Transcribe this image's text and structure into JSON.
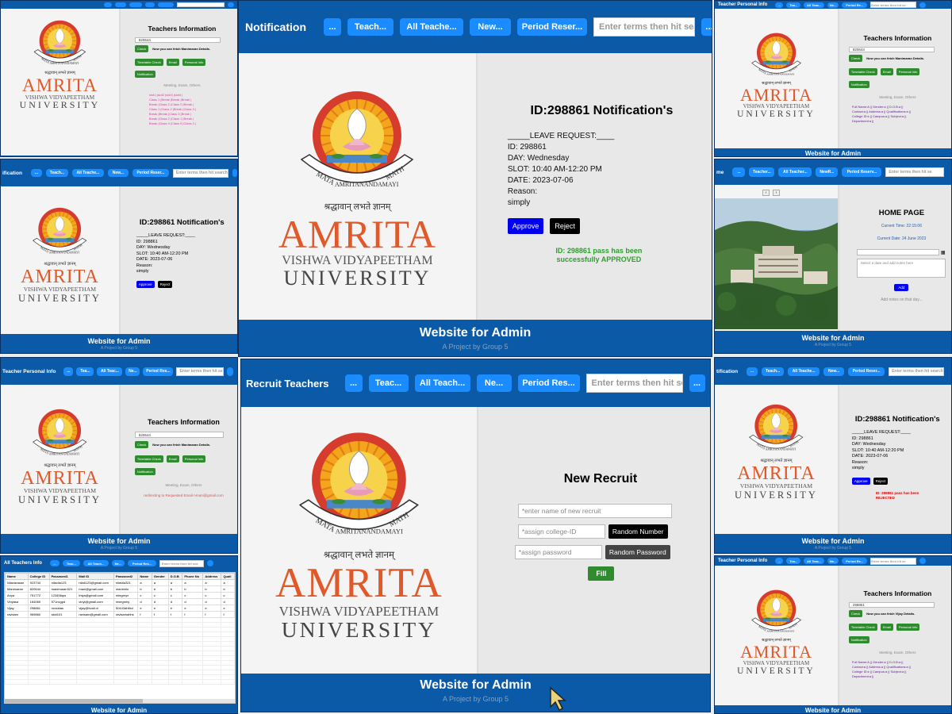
{
  "common": {
    "footer_title": "Website for Admin",
    "footer_sub": "A Project by Group 5",
    "logo_word": "AMRITA",
    "logo_vv": "VISHWA VIDYAPEETHAM",
    "logo_uni": "UNIVERSITY",
    "logo_sanskrit": "श्रद्धावान् लभते ज्ञानम्",
    "seal_top": "MATA",
    "seal_mid": "AMRITANANDAMAYI",
    "seal_end": "MATH",
    "search_placeholder": "Enter terms then hit search",
    "more_btn": "...",
    "brand_color": "#0b5aa8",
    "accent_color": "#1a8cff",
    "logo_color": "#e0592a"
  },
  "notification_big": {
    "title": "Notification",
    "nav": [
      "...",
      "Teach...",
      "All Teache...",
      "New...",
      "Period Reser..."
    ],
    "more": "...",
    "heading": "ID:298861 Notification's",
    "lines": [
      "_____LEAVE REQUEST:____",
      "ID: 298861",
      "DAY: Wednesday",
      "SLOT: 10:40 AM-12:20 PM",
      "DATE: 2023-07-06",
      "Reason:",
      "simply"
    ],
    "approve": "Approve",
    "reject": "Reject",
    "status": "ID: 298861 pass has been successfully APPROVED",
    "status_color": "#2e9e2e"
  },
  "recruit_big": {
    "title": "Recruit Teachers",
    "nav": [
      "...",
      "Teac...",
      "All Teach...",
      "Ne...",
      "Period Res..."
    ],
    "search": "Enter terms then hit sea",
    "more": "...",
    "heading": "New Recruit",
    "name_placeholder": "*enter name of new recruit",
    "id_placeholder": "*assign college-ID",
    "pw_placeholder": "*assign password",
    "random_number": "Random Number",
    "random_password": "Random Password",
    "fill": "Fill"
  },
  "ti_tl": {
    "heading": "Teachers Information",
    "input_value": "820644",
    "check": "Check",
    "check_msg": "Now you can fetch Manimaran Details.",
    "buttons": [
      "Timetable Check",
      "Email",
      "Personal Info"
    ],
    "notification": "Notification",
    "meeting": "Meeting, Exam, Others",
    "timetable": [
      "slot1  |slot2  |slot3  |slot4  |",
      "Class 1 |Break |Break |Break |",
      "Break |Class 2 |Class 2 |Break |",
      "Class 1 |Class 2 |Break |Class 3 |",
      "Break |Break |Class 3 |Break |",
      "Break |Class 2 |Class 1 |Break |",
      "Break |Class 4 |Class 5 |Class 2 |"
    ]
  },
  "notif_small": {
    "title": "Notification",
    "nav": [
      "...",
      "Teach...",
      "All Teache...",
      "New...",
      "Period Reser..."
    ],
    "search": "Enter terms then hit search",
    "heading": "ID:298861 Notification's",
    "lines": [
      "_____LEAVE REQUEST:____",
      "ID: 298861",
      "DAY: Wednesday",
      "SLOT: 10:40 AM-12:20 PM",
      "DATE: 2023-07-06",
      "Reason:",
      "simply"
    ],
    "approve": "Approve",
    "reject": "Reject"
  },
  "teacher_personal_tr": {
    "title": "Teacher Personal Info",
    "nav": [
      "...",
      "Tea...",
      "All Teac...",
      "Ne...",
      "Period Re..."
    ],
    "search": "Enter terms then hit se",
    "heading": "Teachers Information",
    "input_value": "820644",
    "check": "Check",
    "check_msg": "Now you can fetch Manimaran Details.",
    "buttons": [
      "Timetable Check",
      "Email",
      "Personal Info"
    ],
    "notification": "Notification",
    "meeting": "Meeting, Exam, Others",
    "info": [
      "Full Name:A || Gender:a || D.O.B:a ||",
      "Contact:a || Address:a || Qualifications:a ||",
      "College ID:s || Campus:a || Subject:a ||",
      "Department:a ||"
    ]
  },
  "home_panel": {
    "title": "Home",
    "nav": [
      "...",
      "Teacher...",
      "All Teacher...",
      "NewR...",
      "Period Reserv..."
    ],
    "search": "Enter terms then hit se",
    "heading": "HOME PAGE",
    "time": "Current Time: 22:15:06",
    "date": "Current Date: 24 June 2023",
    "note_placeholder": "Select a date and add notes here",
    "add": "Add",
    "add_hint": "Add notes on that day..."
  },
  "ti_ml": {
    "title": "Teacher Personal Info",
    "nav": [
      "...",
      "Tea...",
      "All Teac...",
      "Ne...",
      "Period Res..."
    ],
    "search": "Enter terms then hit se",
    "heading": "Teachers Information",
    "input_value": "820644",
    "check": "Check",
    "check_msg": "Now you can fetch Manimaran Details.",
    "buttons": [
      "Timetable Check",
      "Email",
      "Personal Info"
    ],
    "notification": "Notification",
    "meeting": "Meeting, Exam, Others",
    "redirect": "redirecting to Requested Email->mani@gmail.com"
  },
  "notif_rejected": {
    "title": "Notification",
    "nav": [
      "...",
      "Teach...",
      "All Teache...",
      "New...",
      "Period Reser..."
    ],
    "search": "Enter terms then hit search",
    "heading": "ID:298861 Notification's",
    "lines": [
      "_____LEAVE REQUEST:____",
      "ID: 298861",
      "DAY: Wednesday",
      "SLOT: 10:40 AM-12:20 PM",
      "DATE: 2023-07-06",
      "Reason:",
      "simply"
    ],
    "approve": "Approve",
    "reject": "Reject",
    "status": "ID: 298861 pass has been REJECTED",
    "status_color": "#e00000"
  },
  "all_teachers": {
    "title": "All Teachers Info",
    "nav": [
      "...",
      "Teac...",
      "All Teach...",
      "Ne...",
      "Period Res..."
    ],
    "search": "Enter terms then hit sea",
    "headers": [
      "Name",
      "College ID",
      "Password1",
      "Mail ID",
      "Password2",
      "Name",
      "Gender",
      "D.O.B",
      "Phone No",
      "Address",
      "Quali"
    ],
    "rows": [
      [
        "Nilavarasan",
        "923744",
        "nilavila123",
        "nila6123@gmail.com",
        "nilavila321",
        "a",
        "a",
        "a",
        "a",
        "a",
        "a"
      ],
      [
        "Manimaran",
        "820644",
        "manimaran321",
        "mani@gmail.com",
        "manimilo",
        "b",
        "b",
        "b",
        "b",
        "b",
        "b"
      ],
      [
        "Anya",
        "751772",
        "123456qw",
        "thiya@gmail.com",
        "mlegrnyx",
        "c",
        "c",
        "c",
        "c",
        "c",
        "c"
      ],
      [
        "Vinyasa",
        "164069",
        "571nvgpd",
        "vinyi@gmail.com",
        "mxegmhy",
        "d",
        "d",
        "d",
        "d",
        "d",
        "d"
      ],
      [
        "Vijay",
        "298861",
        "mvicklas",
        "vijay@kvall.nl",
        "50443ahfixd",
        "e",
        "e",
        "e",
        "e",
        "e",
        "e"
      ],
      [
        "ravisam",
        "969860",
        "skid101",
        "ravisam@gmail.com",
        "ravisamahhs",
        "f",
        "f",
        "f",
        "f",
        "f",
        "f"
      ]
    ],
    "empty_rows": 14
  },
  "teacher_personal_br": {
    "title": "Teacher Personal Info",
    "nav": [
      "...",
      "Tea...",
      "All Teac...",
      "Ne...",
      "Period Re..."
    ],
    "search": "Enter terms then hit se",
    "heading": "Teachers Information",
    "input_value": "298861",
    "check": "Check",
    "check_msg": "Now you can fetch Vijay Details.",
    "buttons": [
      "Timetable Check",
      "Email",
      "Personal Info"
    ],
    "notification": "Notification",
    "meeting": "Meeting, Exam, Others",
    "info": [
      "Full Name:A || Gender:a || D.O.B:a ||",
      "Contact:a || Address:a || Qualifications:a ||",
      "College ID:s || Campus:a || Subject:a ||",
      "Department:a ||"
    ]
  }
}
